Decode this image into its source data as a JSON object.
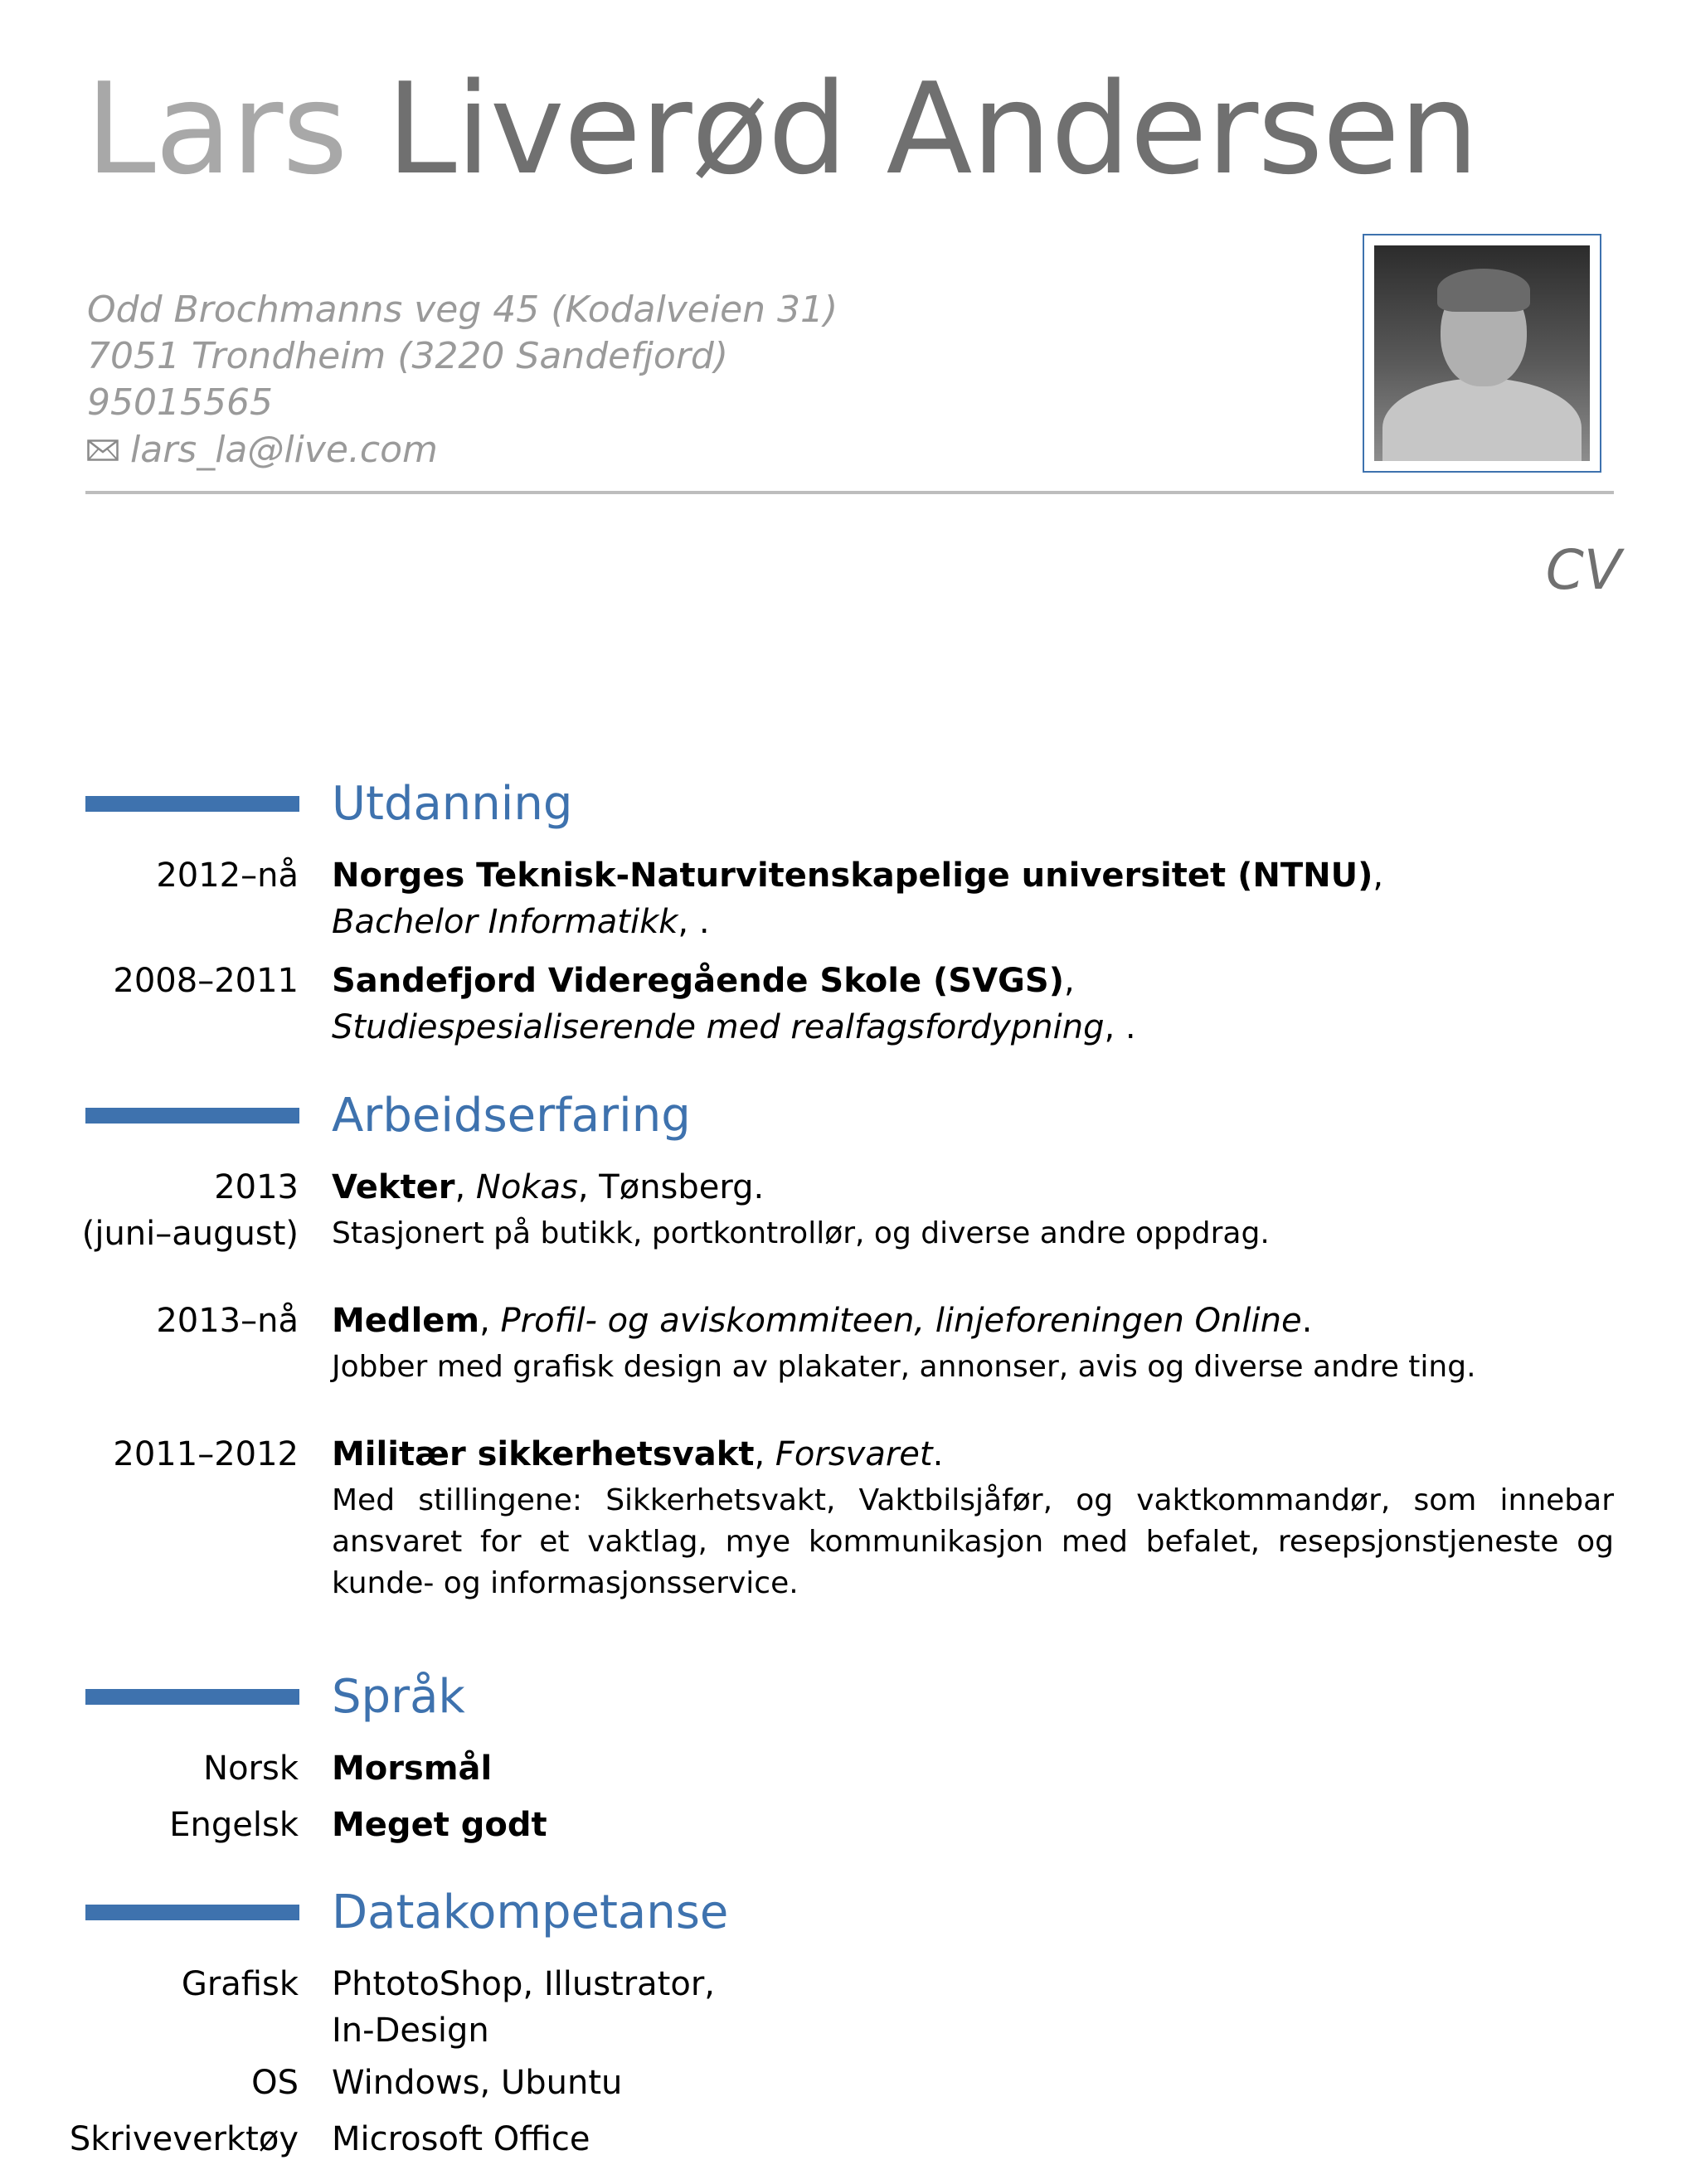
{
  "header": {
    "first_name": "Lars",
    "last_name": "Liverød Andersen",
    "address_line1": "Odd Brochmanns veg 45 (Kodalveien 31)",
    "address_line2": "7051 Trondheim (3220 Sandefjord)",
    "phone": "95015565",
    "email": "lars_la@live.com",
    "email_icon": "envelope-icon",
    "photo": "profile-photo",
    "doc_label": "CV"
  },
  "colors": {
    "accent": "#3e72ae",
    "first_name": "#a8a8a8",
    "last_name": "#707070",
    "contact": "#9a9a9a",
    "rule": "#bdbdbd"
  },
  "education": {
    "title": "Utdanning",
    "entries": [
      {
        "date": "2012–nå",
        "institution": "Norges Teknisk-Naturvitenskapelige universitet (NTNU)",
        "degree": "Bachelor Informatikk",
        "suffix": ", ."
      },
      {
        "date": "2008–2011",
        "institution": "Sandefjord Videregående Skole (SVGS)",
        "degree": "Studiespesialiserende med realfagsfordypning",
        "suffix": ", ."
      }
    ]
  },
  "experience": {
    "title": "Arbeidserfaring",
    "entries": [
      {
        "date": "2013",
        "date_sub": "(juni–august)",
        "role": "Vekter",
        "employer": "Nokas",
        "location": "Tønsberg.",
        "description": "Stasjonert på butikk, portkontrollør, og diverse andre oppdrag."
      },
      {
        "date": "2013–nå",
        "role": "Medlem",
        "employer": "Profil- og aviskommiteen, linjeforeningen Online",
        "description": "Jobber med grafisk design av plakater, annonser, avis og diverse andre ting."
      },
      {
        "date": "2011–2012",
        "role": "Militær sikkerhetsvakt",
        "employer": "Forsvaret",
        "description": "Med stillingene: Sikkerhetsvakt, Vaktbilsjåfør, og vaktkommandør, som innebar ansvaret for et vaktlag, mye kommunikasjon med befalet, resepsjonstjeneste og kunde- og informasjonsservice."
      }
    ]
  },
  "languages": {
    "title": "Språk",
    "entries": [
      {
        "language": "Norsk",
        "level": "Morsmål"
      },
      {
        "language": "Engelsk",
        "level": "Meget godt"
      }
    ]
  },
  "computer": {
    "title": "Datakompetanse",
    "entries": [
      {
        "category": "Grafisk",
        "value_line1": "PhtotoShop, Illustrator,",
        "value_line2": "In-Design"
      },
      {
        "category": "OS",
        "value_line1": "Windows, Ubuntu"
      },
      {
        "category": "Skriveverktøy",
        "value_line1": "Microsoft Office"
      }
    ]
  }
}
